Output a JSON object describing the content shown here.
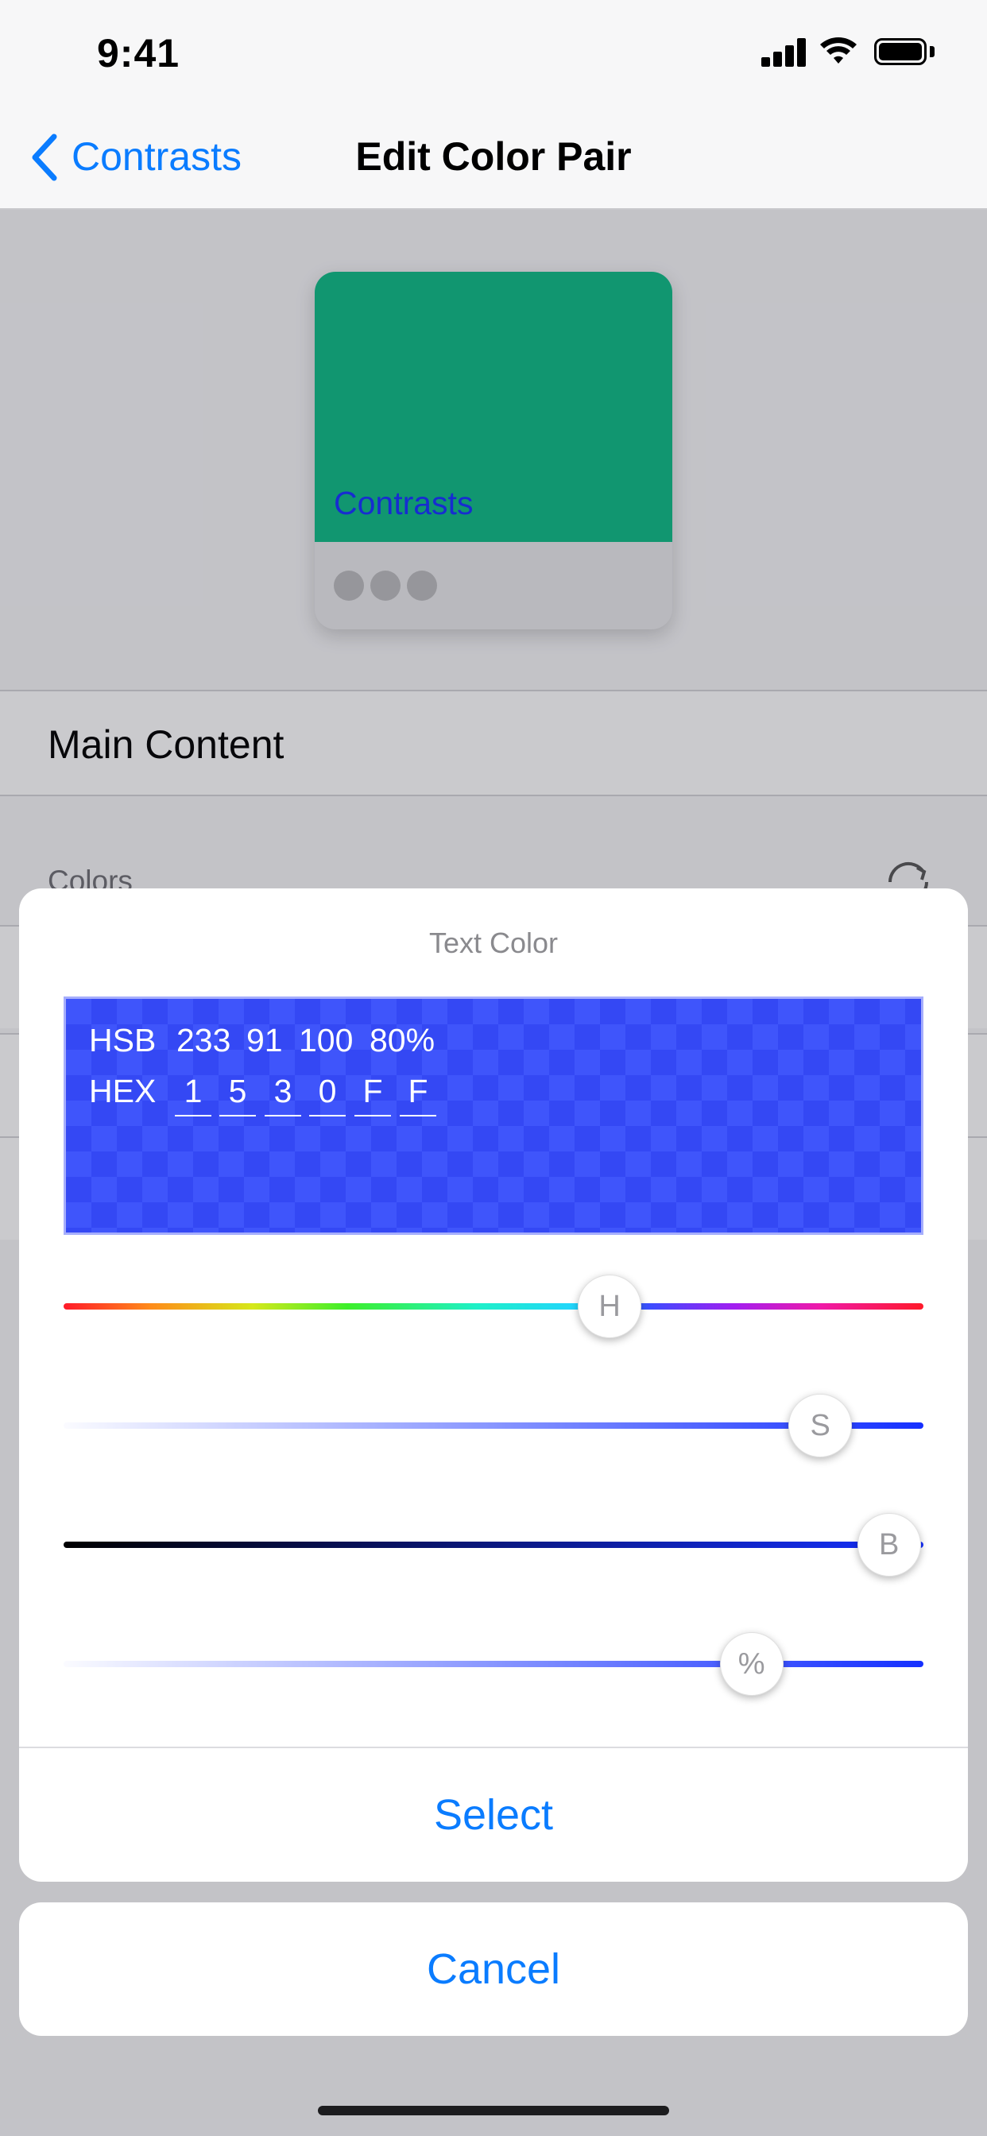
{
  "status_bar": {
    "time": "9:41",
    "icons": [
      "signal-icon",
      "wifi-icon",
      "battery-icon"
    ]
  },
  "nav": {
    "back_label": "Contrasts",
    "title": "Edit Color Pair"
  },
  "preview": {
    "background_color": "#0db883",
    "text_color": "#1530ff",
    "text": "Contrasts"
  },
  "main_content": {
    "label": "Main Content"
  },
  "colors_section": {
    "header": "Colors"
  },
  "picker": {
    "title": "Text Color",
    "hsb_label": "HSB",
    "hsb_values": [
      "233",
      "91",
      "100",
      "80%"
    ],
    "hex_label": "HEX",
    "hex_digits": [
      "1",
      "5",
      "3",
      "0",
      "F",
      "F"
    ],
    "sliders": {
      "hue": {
        "label": "H",
        "position": 0.635
      },
      "saturation": {
        "label": "S",
        "position": 0.88
      },
      "brightness": {
        "label": "B",
        "position": 0.96
      },
      "opacity": {
        "label": "%",
        "position": 0.8
      }
    },
    "select_label": "Select"
  },
  "cancel_label": "Cancel",
  "colors": {
    "accent": "#0a7cff",
    "selected_color": "#1530ff"
  }
}
